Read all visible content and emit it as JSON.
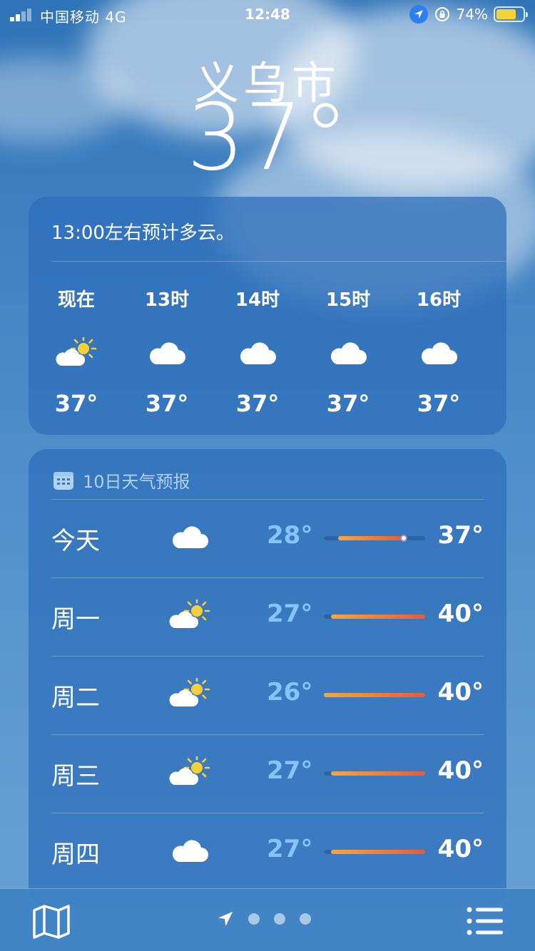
{
  "status_bar": {
    "carrier": "中国移动 4G",
    "time": "12:48",
    "battery_pct": "74%",
    "battery_level": 0.74
  },
  "location": {
    "city": "义乌市",
    "current_temp": "37°"
  },
  "hourly": {
    "summary": "13:00左右预计多云。",
    "items": [
      {
        "label": "现在",
        "icon": "partly-sunny-icon",
        "temp": "37°"
      },
      {
        "label": "13时",
        "icon": "cloud-icon",
        "temp": "37°"
      },
      {
        "label": "14时",
        "icon": "cloud-icon",
        "temp": "37°"
      },
      {
        "label": "15时",
        "icon": "cloud-icon",
        "temp": "37°"
      },
      {
        "label": "16时",
        "icon": "cloud-icon",
        "temp": "37°"
      }
    ]
  },
  "forecast": {
    "title": "10日天气预报",
    "week_min": 26,
    "week_max": 40,
    "days": [
      {
        "day": "今天",
        "icon": "cloud-icon",
        "low": "28°",
        "high": "37°",
        "low_val": 28,
        "high_val": 37,
        "current_val": 37
      },
      {
        "day": "周一",
        "icon": "partly-sunny-icon",
        "low": "27°",
        "high": "40°",
        "low_val": 27,
        "high_val": 40
      },
      {
        "day": "周二",
        "icon": "partly-sunny-icon",
        "low": "26°",
        "high": "40°",
        "low_val": 26,
        "high_val": 40
      },
      {
        "day": "周三",
        "icon": "partly-sunny-icon",
        "low": "27°",
        "high": "40°",
        "low_val": 27,
        "high_val": 40
      },
      {
        "day": "周四",
        "icon": "cloud-icon",
        "low": "27°",
        "high": "40°",
        "low_val": 27,
        "high_val": 40
      }
    ]
  },
  "bottom_bar": {
    "pages": 3,
    "icons": [
      "map-icon",
      "location-arrow-icon",
      "list-icon"
    ]
  }
}
